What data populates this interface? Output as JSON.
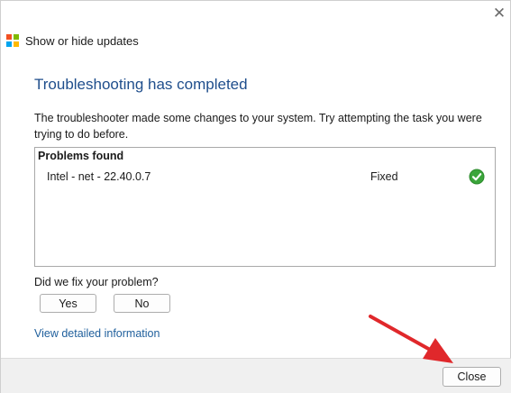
{
  "window": {
    "title": "Show or hide updates",
    "close_glyph": "✕"
  },
  "main": {
    "heading": "Troubleshooting has completed",
    "message": "The troubleshooter made some changes to your system. Try attempting the task you were trying to do before.",
    "problems": {
      "header": "Problems found",
      "rows": [
        {
          "name": "Intel - net - 22.40.0.7",
          "status": "Fixed",
          "icon": "green-check-icon"
        }
      ]
    },
    "question": "Did we fix your problem?",
    "yes_label": "Yes",
    "no_label": "No",
    "details_link": "View detailed information"
  },
  "footer": {
    "close_label": "Close"
  },
  "colors": {
    "heading": "#1f4e8c",
    "link": "#1f5f9c",
    "check": "#3aa53a",
    "arrow": "#e0282b",
    "logo": [
      "#f25022",
      "#7fba00",
      "#00a4ef",
      "#ffb900"
    ]
  }
}
